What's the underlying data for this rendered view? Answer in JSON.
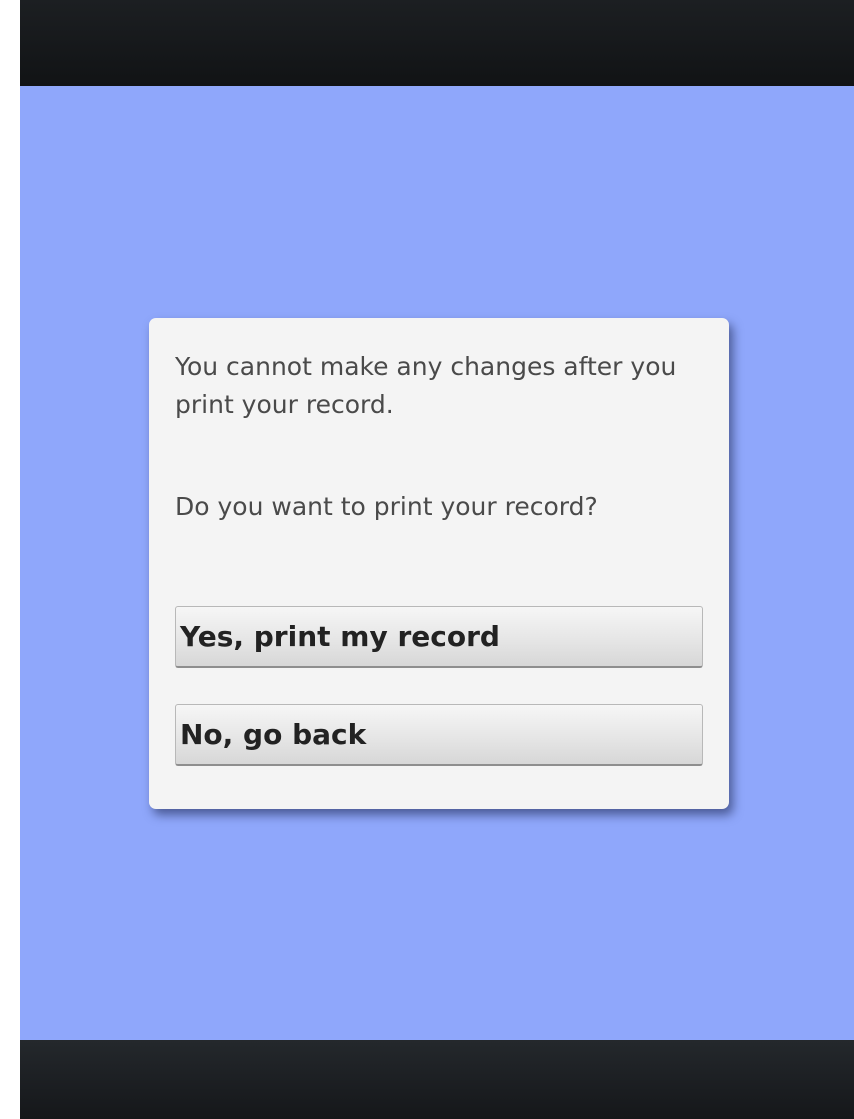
{
  "dialog": {
    "message_line_1": "You cannot make any changes after you print your record.",
    "message_line_2": "Do you  want to print your record?",
    "yes_button_label": "Yes, print my record",
    "no_button_label": "No, go back"
  },
  "colors": {
    "background": "#8fa7fb",
    "bars": "#15171a",
    "dialog": "#f4f4f4",
    "button": "#e6e6e6"
  }
}
